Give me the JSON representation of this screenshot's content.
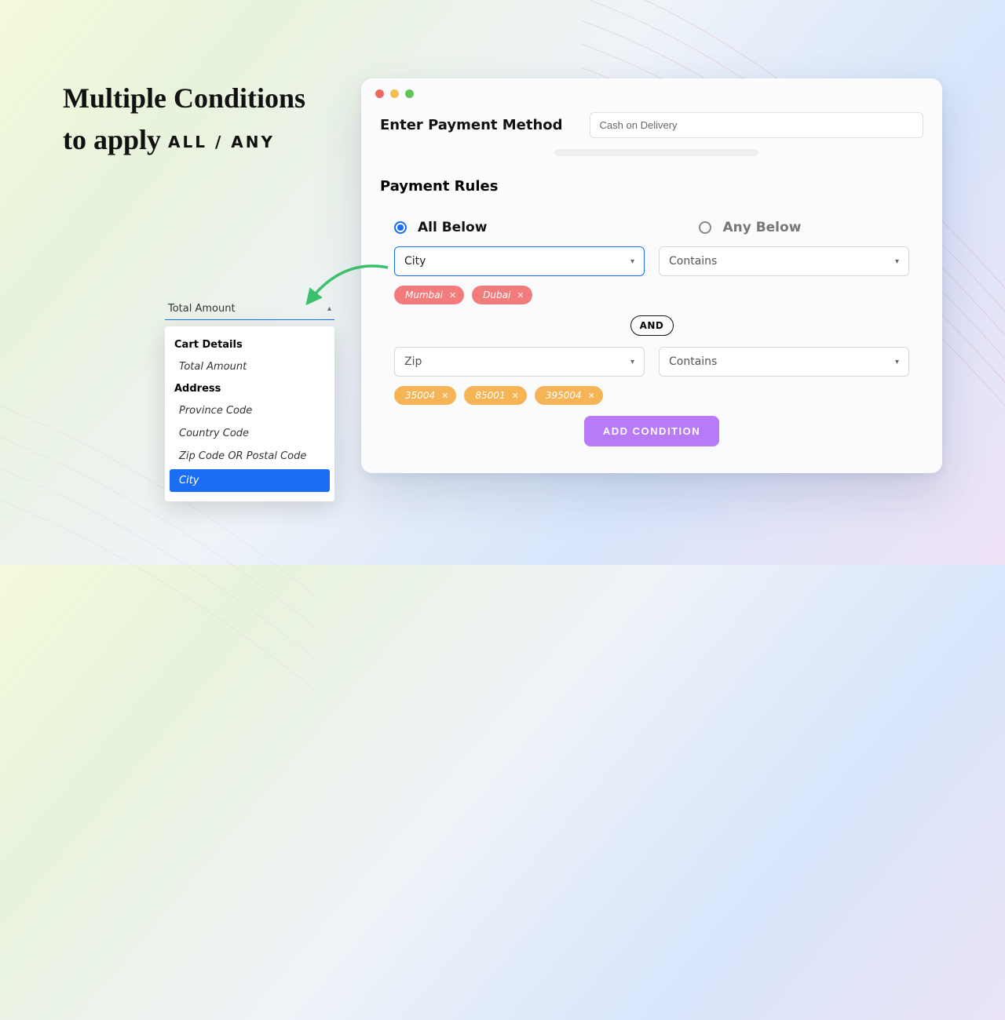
{
  "headline": {
    "line1": "Multiple Conditions",
    "line2_a": "to apply ",
    "line2_b": "ALL / ANY"
  },
  "titlebar": {
    "colors": [
      "#ec6a5e",
      "#f4bf4f",
      "#61c454"
    ]
  },
  "payment_method": {
    "label": "Enter Payment Method",
    "value": "Cash on Delivery"
  },
  "rules": {
    "header": "Payment Rules",
    "radios": {
      "all": "All Below",
      "any": "Any Below",
      "selected": "all"
    },
    "conditions": [
      {
        "field": "City",
        "op": "Contains",
        "active": true,
        "chip_style": "pink",
        "chips": [
          "Mumbai",
          "Dubai"
        ]
      },
      {
        "field": "Zip",
        "op": "Contains",
        "active": false,
        "chip_style": "orange",
        "chips": [
          "35004",
          "85001",
          "395004"
        ]
      }
    ],
    "joiner": "AND",
    "add_label": "ADD CONDITION"
  },
  "dropdown": {
    "selected": "Total Amount",
    "groups": [
      {
        "title": "Cart Details",
        "items": [
          "Total Amount"
        ]
      },
      {
        "title": "Address",
        "items": [
          "Province Code",
          "Country Code",
          "Zip Code OR Postal Code",
          "City"
        ]
      }
    ],
    "highlighted": "City"
  }
}
